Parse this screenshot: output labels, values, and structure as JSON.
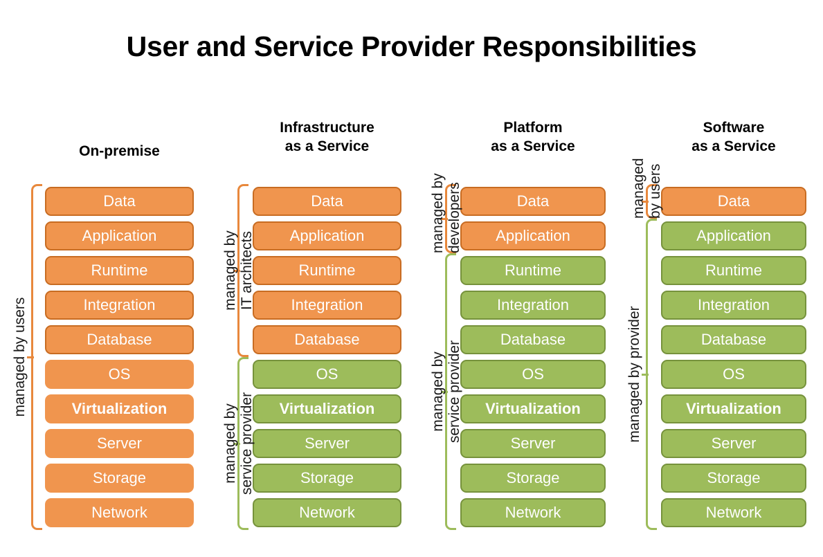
{
  "title": "User and Service Provider Responsibilities",
  "layers": [
    "Data",
    "Application",
    "Runtime",
    "Integration",
    "Database",
    "OS",
    "Virtualization",
    "Server",
    "Storage",
    "Network"
  ],
  "colors": {
    "orange_fill": "#F0954E",
    "orange_border": "#C86C22",
    "orange_bracket": "#E8883C",
    "green_fill": "#9DBC5B",
    "green_border": "#76923C",
    "green_bracket": "#9DBC5B",
    "text_on_box": "#FFFFFF",
    "title_text": "#000000"
  },
  "columns": [
    {
      "id": "on-premise",
      "header_line1": "On-premise",
      "header_line2": "",
      "cells": [
        {
          "label": "Data",
          "color": "orange",
          "bordered": true,
          "bold": false
        },
        {
          "label": "Application",
          "color": "orange",
          "bordered": true,
          "bold": false
        },
        {
          "label": "Runtime",
          "color": "orange",
          "bordered": true,
          "bold": false
        },
        {
          "label": "Integration",
          "color": "orange",
          "bordered": true,
          "bold": false
        },
        {
          "label": "Database",
          "color": "orange",
          "bordered": true,
          "bold": false
        },
        {
          "label": "OS",
          "color": "orange",
          "bordered": false,
          "bold": false
        },
        {
          "label": "Virtualization",
          "color": "orange",
          "bordered": false,
          "bold": true
        },
        {
          "label": "Server",
          "color": "orange",
          "bordered": false,
          "bold": false
        },
        {
          "label": "Storage",
          "color": "orange",
          "bordered": false,
          "bold": false
        },
        {
          "label": "Network",
          "color": "orange",
          "bordered": false,
          "bold": false
        }
      ]
    },
    {
      "id": "infrastructure-as-a-service",
      "header_line1": "Infrastructure",
      "header_line2": "as a Service",
      "cells": [
        {
          "label": "Data",
          "color": "orange",
          "bordered": true,
          "bold": false
        },
        {
          "label": "Application",
          "color": "orange",
          "bordered": true,
          "bold": false
        },
        {
          "label": "Runtime",
          "color": "orange",
          "bordered": true,
          "bold": false
        },
        {
          "label": "Integration",
          "color": "orange",
          "bordered": true,
          "bold": false
        },
        {
          "label": "Database",
          "color": "orange",
          "bordered": true,
          "bold": false
        },
        {
          "label": "OS",
          "color": "green",
          "bordered": true,
          "bold": false
        },
        {
          "label": "Virtualization",
          "color": "green",
          "bordered": true,
          "bold": true
        },
        {
          "label": "Server",
          "color": "green",
          "bordered": true,
          "bold": false
        },
        {
          "label": "Storage",
          "color": "green",
          "bordered": true,
          "bold": false
        },
        {
          "label": "Network",
          "color": "green",
          "bordered": true,
          "bold": false
        }
      ]
    },
    {
      "id": "platform-as-a-service",
      "header_line1": "Platform",
      "header_line2": "as a Service",
      "cells": [
        {
          "label": "Data",
          "color": "orange",
          "bordered": true,
          "bold": false
        },
        {
          "label": "Application",
          "color": "orange",
          "bordered": true,
          "bold": false
        },
        {
          "label": "Runtime",
          "color": "green",
          "bordered": true,
          "bold": false
        },
        {
          "label": "Integration",
          "color": "green",
          "bordered": true,
          "bold": false
        },
        {
          "label": "Database",
          "color": "green",
          "bordered": true,
          "bold": false
        },
        {
          "label": "OS",
          "color": "green",
          "bordered": true,
          "bold": false
        },
        {
          "label": "Virtualization",
          "color": "green",
          "bordered": true,
          "bold": true
        },
        {
          "label": "Server",
          "color": "green",
          "bordered": true,
          "bold": false
        },
        {
          "label": "Storage",
          "color": "green",
          "bordered": true,
          "bold": false
        },
        {
          "label": "Network",
          "color": "green",
          "bordered": true,
          "bold": false
        }
      ]
    },
    {
      "id": "software-as-a-service",
      "header_line1": "Software",
      "header_line2": "as a Service",
      "cells": [
        {
          "label": "Data",
          "color": "orange",
          "bordered": true,
          "bold": false
        },
        {
          "label": "Application",
          "color": "green",
          "bordered": true,
          "bold": false
        },
        {
          "label": "Runtime",
          "color": "green",
          "bordered": true,
          "bold": false
        },
        {
          "label": "Integration",
          "color": "green",
          "bordered": true,
          "bold": false
        },
        {
          "label": "Database",
          "color": "green",
          "bordered": true,
          "bold": false
        },
        {
          "label": "OS",
          "color": "green",
          "bordered": true,
          "bold": false
        },
        {
          "label": "Virtualization",
          "color": "green",
          "bordered": true,
          "bold": true
        },
        {
          "label": "Server",
          "color": "green",
          "bordered": true,
          "bold": false
        },
        {
          "label": "Storage",
          "color": "green",
          "bordered": true,
          "bold": false
        },
        {
          "label": "Network",
          "color": "green",
          "bordered": true,
          "bold": false
        }
      ]
    }
  ],
  "annotations": [
    {
      "id": "on-premise-users",
      "line1": "managed by users",
      "line2": "",
      "color": "orange",
      "from_row": 0,
      "to_row": 9
    },
    {
      "id": "iaas-it-architects",
      "line1": "managed by",
      "line2": "IT architects",
      "color": "orange",
      "from_row": 0,
      "to_row": 4
    },
    {
      "id": "iaas-service-provider",
      "line1": "managed by",
      "line2": "service provider",
      "color": "green",
      "from_row": 5,
      "to_row": 9
    },
    {
      "id": "paas-developers",
      "line1": "managed by",
      "line2": "developers",
      "color": "orange",
      "from_row": 0,
      "to_row": 1
    },
    {
      "id": "paas-service-provider",
      "line1": "managed by",
      "line2": "service provider",
      "color": "green",
      "from_row": 2,
      "to_row": 9
    },
    {
      "id": "saas-users",
      "line1": "managed",
      "line2": "by users",
      "color": "orange",
      "from_row": 0,
      "to_row": 0
    },
    {
      "id": "saas-provider",
      "line1": "managed by provider",
      "line2": "",
      "color": "green",
      "from_row": 1,
      "to_row": 9
    }
  ]
}
